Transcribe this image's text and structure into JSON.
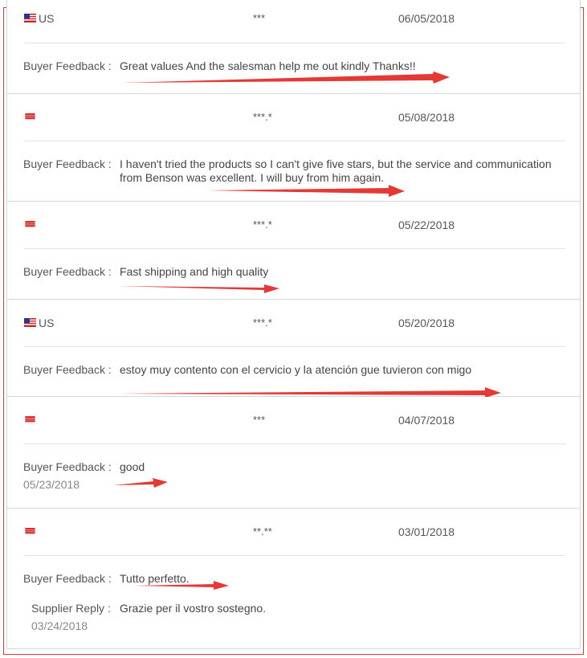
{
  "labels": {
    "buyer_feedback": "Buyer Feedback :",
    "supplier_reply": "Supplier Reply :"
  },
  "colors": {
    "annotation_arrow": "#e53935",
    "frame_border": "#e53935",
    "divider": "#dfe3e8"
  },
  "reviews": [
    {
      "country": "US",
      "name": "***",
      "date": "06/05/2018",
      "feedback": "Great values And the salesman help me out kindly Thanks!!"
    },
    {
      "country": "",
      "name": "***.*",
      "date": "05/08/2018",
      "feedback": "I haven't tried the products so I can't give five stars, but the service and communication from Benson was excellent. I will buy from him again."
    },
    {
      "country": "",
      "name": "***.*",
      "date": "05/22/2018",
      "feedback": "Fast shipping and high quality"
    },
    {
      "country": "US",
      "name": "***.*",
      "date": "05/20/2018",
      "feedback": "estoy muy contento con el cervicio y la atención gue tuvieron con migo"
    },
    {
      "country": "",
      "name": "***",
      "date": "04/07/2018",
      "feedback": "good",
      "feedback_date": "05/23/2018"
    },
    {
      "country": "",
      "name": "**.**",
      "date": "03/01/2018",
      "feedback": "Tutto perfetto.",
      "reply": "Grazie per il vostro sostegno.",
      "reply_date": "03/24/2018"
    }
  ]
}
